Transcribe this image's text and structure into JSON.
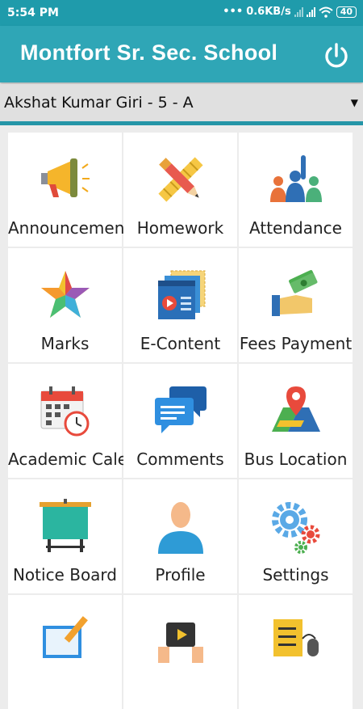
{
  "status_bar": {
    "time": "5:54 PM",
    "network_speed": "0.6KB/s",
    "battery": "40"
  },
  "header": {
    "title": "Montfort Sr. Sec. School",
    "power_icon": "power-icon"
  },
  "student_selector": {
    "value": "Akshat Kumar Giri - 5 - A"
  },
  "menu": {
    "items": [
      {
        "label": "Announcement",
        "icon": "megaphone-icon"
      },
      {
        "label": "Homework",
        "icon": "pencil-ruler-icon"
      },
      {
        "label": "Attendance",
        "icon": "raised-hand-group-icon"
      },
      {
        "label": "Marks",
        "icon": "star-icon"
      },
      {
        "label": "E-Content",
        "icon": "video-content-icon"
      },
      {
        "label": "Fees Payment",
        "icon": "money-hand-icon"
      },
      {
        "label": "Academic Calendar",
        "icon": "calendar-clock-icon"
      },
      {
        "label": "Comments",
        "icon": "chat-bubbles-icon"
      },
      {
        "label": "Bus Location",
        "icon": "map-pin-icon"
      },
      {
        "label": "Notice Board",
        "icon": "notice-board-icon"
      },
      {
        "label": "Profile",
        "icon": "user-icon"
      },
      {
        "label": "Settings",
        "icon": "gears-icon"
      },
      {
        "label": "",
        "icon": "edit-note-icon"
      },
      {
        "label": "",
        "icon": "video-hands-icon"
      },
      {
        "label": "",
        "icon": "checklist-mouse-icon"
      }
    ]
  }
}
